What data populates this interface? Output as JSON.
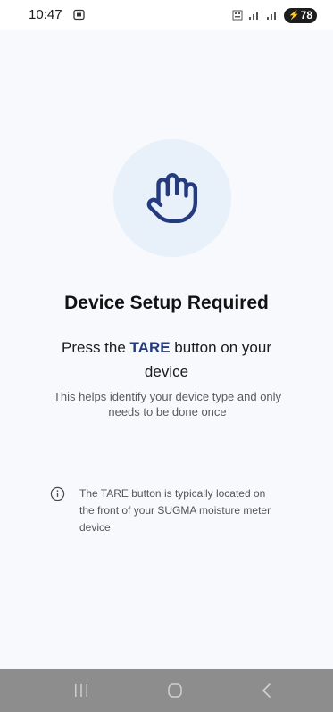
{
  "status_bar": {
    "time": "10:47",
    "battery": "78",
    "icons": [
      "screenshot-icon",
      "nfc-icon",
      "signal-icon",
      "signal-icon-2",
      "charging-bolt-icon"
    ]
  },
  "main": {
    "hero_icon": "hand-stop-icon",
    "title": "Device Setup Required",
    "instruction_before": "Press the ",
    "instruction_highlight": "TARE",
    "instruction_after": " button on your device",
    "subtext": "This helps identify your device type and only needs to be done once",
    "info_text": "The TARE button is typically located on the front of your SUGMA moisture meter device",
    "info_icon": "info-icon"
  },
  "nav_bar": {
    "buttons": [
      "recent-apps-icon",
      "home-icon",
      "back-icon"
    ]
  },
  "colors": {
    "accent": "#243b7e",
    "hero_bg": "#e8f0fa",
    "page_bg": "#f7f9fd",
    "nav_bg": "#8d8d8d"
  }
}
